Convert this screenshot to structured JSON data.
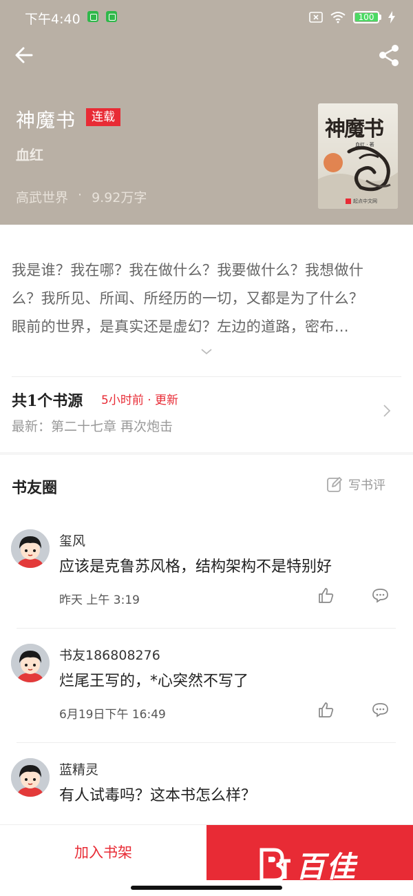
{
  "status_bar": {
    "time": "下午4:40",
    "battery": "100",
    "icons": [
      "app-notification-icon",
      "app-notification-icon",
      "sim-card-icon",
      "wifi-icon",
      "battery-icon",
      "charging-icon"
    ]
  },
  "header": {
    "background_color": "#b9b0a5",
    "back_icon": "arrow-left-icon",
    "share_icon": "share-icon"
  },
  "book": {
    "title": "神魔书",
    "status_tag": "连载",
    "author": "血红",
    "genre": "高武世界",
    "separator": "·",
    "word_count": "9.92万字",
    "cover": {
      "title": "神魔书",
      "author_line": "血红 · 著",
      "publisher": "起点中文网"
    }
  },
  "synopsis": {
    "lines": [
      "我是谁？我在哪？我在做什么？我要做什么？我想做什",
      "么？我所见、所闻、所经历的一切，又都是为了什么？",
      "眼前的世界，是真实还是虚幻？左边的道路，密布…"
    ],
    "expand_icon": "chevron-down-icon"
  },
  "source": {
    "title": "共1个书源",
    "update": "5小时前 · 更新",
    "latest": "最新：第二十七章 再次炮击"
  },
  "book_circle": {
    "title": "书友圈",
    "write_review": "写书评",
    "comments": [
      {
        "user": "玺风",
        "text": "应该是克鲁苏风格，结构架构不是特别好",
        "time": "昨天 上午 3:19"
      },
      {
        "user": "书友186808276",
        "text": "烂尾王写的，*心突然不写了",
        "time": "6月19日下午 16:49"
      },
      {
        "user": "蓝精灵",
        "text": "有人试毒吗？这本书怎么样？",
        "time": ""
      }
    ]
  },
  "bottom_bar": {
    "add_to_shelf": "加入书架",
    "accent_color": "#e82b35"
  },
  "watermark": {
    "text": "百佳"
  }
}
